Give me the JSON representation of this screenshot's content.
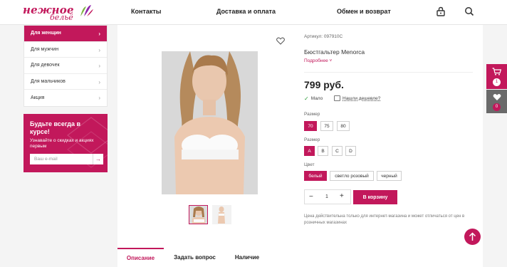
{
  "header": {
    "logo_line1": "нежное",
    "logo_line2": "бельё",
    "nav": [
      "Контакты",
      "Доставка и оплата",
      "Обмен и возврат"
    ]
  },
  "sidebar": {
    "items": [
      {
        "label": "Для женщин",
        "active": true
      },
      {
        "label": "Для мужчин",
        "active": false
      },
      {
        "label": "Для девочек",
        "active": false
      },
      {
        "label": "Для мальчиков",
        "active": false
      },
      {
        "label": "Акция",
        "active": false
      }
    ]
  },
  "promo": {
    "title": "Будьте всегда в курсе!",
    "subtitle": "Узнавайте о скидках и акциях первым",
    "placeholder": "Ваш e-mail"
  },
  "product": {
    "sku": "Артикул: 097910C",
    "name": "Бюстгальтер Menorca",
    "more_link": "Подробнее",
    "price": "799 руб.",
    "stock": "Мало",
    "cheaper": "Нашли дешевле?",
    "size_label_1": "Размер",
    "sizes_1": [
      "70",
      "75",
      "80"
    ],
    "size_label_2": "Размер",
    "sizes_2": [
      "A",
      "B",
      "C",
      "D"
    ],
    "color_label": "Цвет",
    "colors": [
      "белый",
      "светло розовый",
      "черный"
    ],
    "quantity": "1",
    "cart_button": "В корзину",
    "note": "Цена действительна только для интернет-магазина и может отличаться от цен в розничных магазинах"
  },
  "tabs": [
    "Описание",
    "Задать вопрос",
    "Наличие"
  ],
  "side": {
    "cart_count": "1",
    "fav_count": "0"
  },
  "colors": {
    "accent": "#c2185b",
    "success": "#2e9d3a"
  }
}
